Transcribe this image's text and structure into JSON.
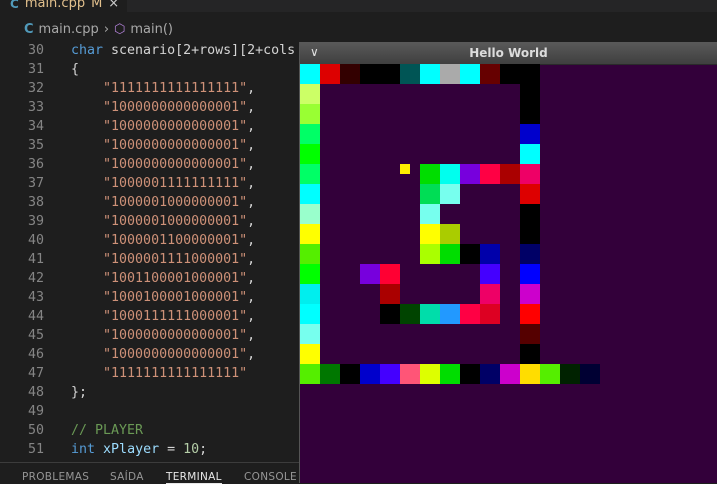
{
  "tab": {
    "icon_label": "C",
    "filename": "main.cpp",
    "status": "M",
    "close": "×"
  },
  "breadcrumb": {
    "file": "main.cpp",
    "separator": "›",
    "symbol": "main()"
  },
  "editor": {
    "lines": [
      {
        "n": "30",
        "parts": [
          [
            "kw",
            "char"
          ],
          [
            "p",
            " scenario[2+rows][2+cols"
          ]
        ]
      },
      {
        "n": "31",
        "parts": [
          [
            "p",
            "{"
          ]
        ]
      },
      {
        "n": "32",
        "parts": [
          [
            "p",
            "    "
          ],
          [
            "str",
            "\"1111111111111111\""
          ],
          [
            "p",
            ","
          ]
        ]
      },
      {
        "n": "33",
        "parts": [
          [
            "p",
            "    "
          ],
          [
            "str",
            "\"1000000000000001\""
          ],
          [
            "p",
            ","
          ]
        ]
      },
      {
        "n": "34",
        "parts": [
          [
            "p",
            "    "
          ],
          [
            "str",
            "\"1000000000000001\""
          ],
          [
            "p",
            ","
          ]
        ]
      },
      {
        "n": "35",
        "parts": [
          [
            "p",
            "    "
          ],
          [
            "str",
            "\"1000000000000001\""
          ],
          [
            "p",
            ","
          ]
        ]
      },
      {
        "n": "36",
        "parts": [
          [
            "p",
            "    "
          ],
          [
            "str",
            "\"1000000000000001\""
          ],
          [
            "p",
            ","
          ]
        ]
      },
      {
        "n": "37",
        "parts": [
          [
            "p",
            "    "
          ],
          [
            "str",
            "\"1000001111111111\""
          ],
          [
            "p",
            ","
          ]
        ]
      },
      {
        "n": "38",
        "parts": [
          [
            "p",
            "    "
          ],
          [
            "str",
            "\"1000001000000001\""
          ],
          [
            "p",
            ","
          ]
        ]
      },
      {
        "n": "39",
        "parts": [
          [
            "p",
            "    "
          ],
          [
            "str",
            "\"1000001000000001\""
          ],
          [
            "p",
            ","
          ]
        ]
      },
      {
        "n": "40",
        "parts": [
          [
            "p",
            "    "
          ],
          [
            "str",
            "\"1000001100000001\""
          ],
          [
            "p",
            ","
          ]
        ]
      },
      {
        "n": "41",
        "parts": [
          [
            "p",
            "    "
          ],
          [
            "str",
            "\"1000001111000001\""
          ],
          [
            "p",
            ","
          ]
        ]
      },
      {
        "n": "42",
        "parts": [
          [
            "p",
            "    "
          ],
          [
            "str",
            "\"1001100001000001\""
          ],
          [
            "p",
            ","
          ]
        ]
      },
      {
        "n": "43",
        "parts": [
          [
            "p",
            "    "
          ],
          [
            "str",
            "\"1000100001000001\""
          ],
          [
            "p",
            ","
          ]
        ]
      },
      {
        "n": "44",
        "parts": [
          [
            "p",
            "    "
          ],
          [
            "str",
            "\"1000111111000001\""
          ],
          [
            "p",
            ","
          ]
        ]
      },
      {
        "n": "45",
        "parts": [
          [
            "p",
            "    "
          ],
          [
            "str",
            "\"1000000000000001\""
          ],
          [
            "p",
            ","
          ]
        ]
      },
      {
        "n": "46",
        "parts": [
          [
            "p",
            "    "
          ],
          [
            "str",
            "\"1000000000000001\""
          ],
          [
            "p",
            ","
          ]
        ]
      },
      {
        "n": "47",
        "parts": [
          [
            "p",
            "    "
          ],
          [
            "str",
            "\"1111111111111111\""
          ]
        ]
      },
      {
        "n": "48",
        "parts": [
          [
            "p",
            "};"
          ]
        ]
      },
      {
        "n": "49",
        "parts": [
          [
            "p",
            ""
          ]
        ]
      },
      {
        "n": "50",
        "parts": [
          [
            "cm",
            "// PLAYER"
          ]
        ]
      },
      {
        "n": "51",
        "parts": [
          [
            "kw",
            "int"
          ],
          [
            "p",
            " "
          ],
          [
            "var",
            "xPlayer"
          ],
          [
            "p",
            " = "
          ],
          [
            "num",
            "10"
          ],
          [
            "p",
            ";"
          ]
        ]
      }
    ]
  },
  "panel_tabs": [
    {
      "label": "PROBLEMAS",
      "active": false
    },
    {
      "label": "SAÍDA",
      "active": false
    },
    {
      "label": "TERMINAL",
      "active": true
    },
    {
      "label": "CONSOLE DE DEPURAÇÃO",
      "active": false
    }
  ],
  "game_window": {
    "title": "Hello World",
    "menu_glyph": "∨",
    "background": "#33003a",
    "player_color": "#ffee00",
    "player_col": 5,
    "player_row": 5,
    "colors": {
      "a": "#00ffff",
      "b": "#d08888",
      "c": "#dd0000",
      "d": "#330000",
      "e": "#000000",
      "f": "#005555",
      "g": "#aaaaaa",
      "h": "#660000",
      "i": "#55ee00",
      "j": "#00dd00",
      "k": "#ccff66",
      "l": "#99ff33",
      "m": "#00ff66",
      "n": "#00ffee",
      "o": "#99ffcc",
      "p": "#ffff00",
      "q": "#00ff00",
      "r": "#00eeee",
      "s": "#0000cc",
      "t": "#0000aa",
      "u": "#ee0066",
      "v": "#000066",
      "w": "#0000ff",
      "x": "#cc00cc",
      "y": "#ff0000",
      "z": "#550000",
      "A": "#007700",
      "B": "#4400ff",
      "C": "#ff5577",
      "D": "#ffdd00",
      "E": "#000033",
      "F": "#77ffee",
      "G": "#ffee44",
      "H": "#aacc00",
      "I": "#7700dd",
      "J": "#aa0000",
      "K": "#004400",
      "L": "#00ddaa",
      "M": "#2299ff",
      "N": "#ff0044",
      "O": "#dd0022",
      "P": "#ddff00",
      "Q": "#00cc66",
      "R": "#00dd55"
    },
    "map": [
      "acdeefagahee",
      "k..........e",
      "l..........e",
      "m..........s",
      "q..........a",
      "m......Fg...",
      "a......F....",
      "o...........",
      "p...........",
      "i...........",
      "q...........",
      "r...........",
      "a...........",
      "F...........",
      "p...........",
      "i..........."
    ]
  }
}
